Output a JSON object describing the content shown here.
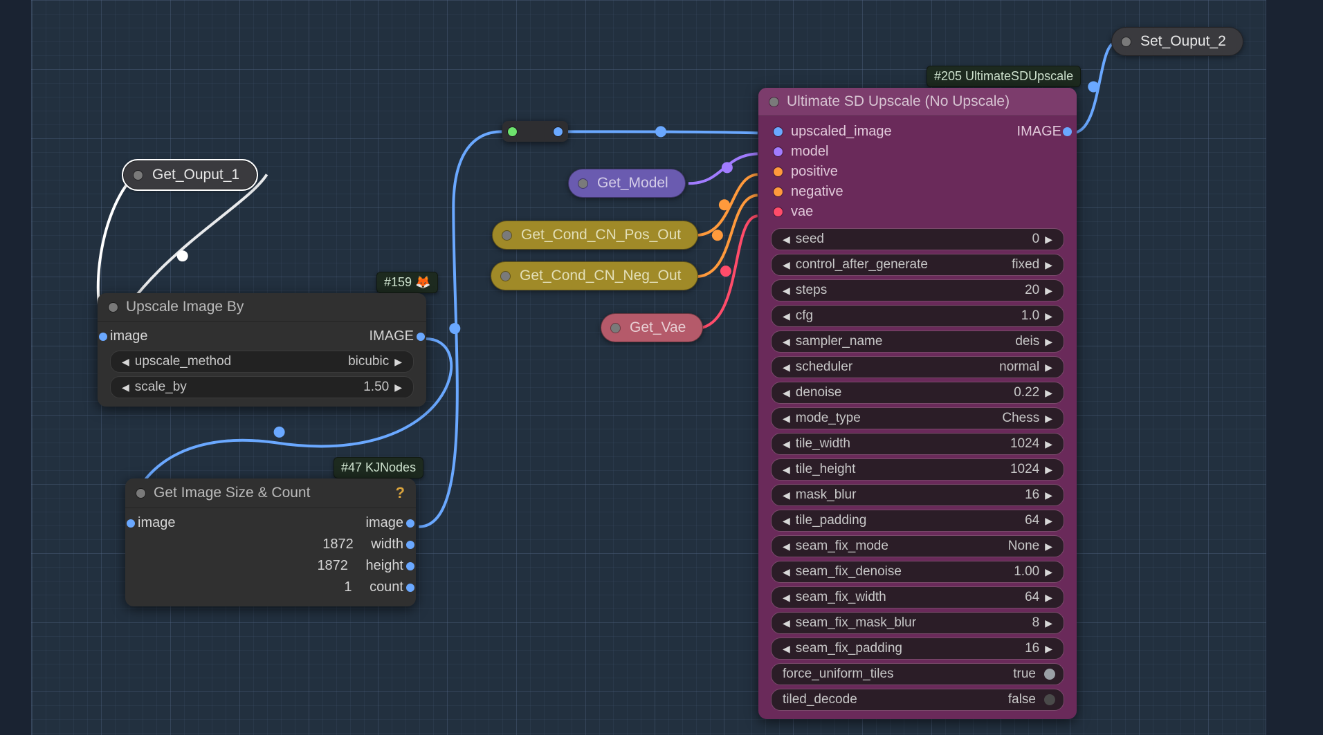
{
  "pills": {
    "get_output_1": "Get_Ouput_1",
    "set_output_2": "Set_Ouput_2",
    "get_model": "Get_Model",
    "get_cond_pos": "Get_Cond_CN_Pos_Out",
    "get_cond_neg": "Get_Cond_CN_Neg_Out",
    "get_vae": "Get_Vae"
  },
  "badges": {
    "b159": "#159 🦊",
    "b47": "#47 KJNodes",
    "b205": "#205 UltimateSDUpscale"
  },
  "upscale_node": {
    "title": "Upscale Image By",
    "input": "image",
    "output": "IMAGE",
    "widgets": {
      "method_label": "upscale_method",
      "method_value": "bicubic",
      "scale_label": "scale_by",
      "scale_value": "1.50"
    }
  },
  "size_node": {
    "title": "Get Image Size & Count",
    "input": "image",
    "outputs": {
      "image_label": "image",
      "width_label": "width",
      "width_value": "1872",
      "height_label": "height",
      "height_value": "1872",
      "count_label": "count",
      "count_value": "1"
    }
  },
  "sd_node": {
    "title": "Ultimate SD Upscale (No Upscale)",
    "inputs": {
      "upscaled_image": "upscaled_image",
      "model": "model",
      "positive": "positive",
      "negative": "negative",
      "vae": "vae"
    },
    "output": "IMAGE",
    "widgets": [
      {
        "label": "seed",
        "value": "0",
        "arrows": true
      },
      {
        "label": "control_after_generate",
        "value": "fixed",
        "arrows": true
      },
      {
        "label": "steps",
        "value": "20",
        "arrows": true
      },
      {
        "label": "cfg",
        "value": "1.0",
        "arrows": true
      },
      {
        "label": "sampler_name",
        "value": "deis",
        "arrows": true
      },
      {
        "label": "scheduler",
        "value": "normal",
        "arrows": true
      },
      {
        "label": "denoise",
        "value": "0.22",
        "arrows": true
      },
      {
        "label": "mode_type",
        "value": "Chess",
        "arrows": true
      },
      {
        "label": "tile_width",
        "value": "1024",
        "arrows": true
      },
      {
        "label": "tile_height",
        "value": "1024",
        "arrows": true
      },
      {
        "label": "mask_blur",
        "value": "16",
        "arrows": true
      },
      {
        "label": "tile_padding",
        "value": "64",
        "arrows": true
      },
      {
        "label": "seam_fix_mode",
        "value": "None",
        "arrows": true
      },
      {
        "label": "seam_fix_denoise",
        "value": "1.00",
        "arrows": true
      },
      {
        "label": "seam_fix_width",
        "value": "64",
        "arrows": true
      },
      {
        "label": "seam_fix_mask_blur",
        "value": "8",
        "arrows": true
      },
      {
        "label": "seam_fix_padding",
        "value": "16",
        "arrows": true
      },
      {
        "label": "force_uniform_tiles",
        "value": "true",
        "toggle": "on"
      },
      {
        "label": "tiled_decode",
        "value": "false",
        "toggle": "off"
      }
    ]
  },
  "colors": {
    "blue": "#6aa8ff",
    "purple": "#a17cff",
    "orange": "#ff9a3c",
    "red": "#ff4c6a",
    "green": "#6de36d"
  }
}
